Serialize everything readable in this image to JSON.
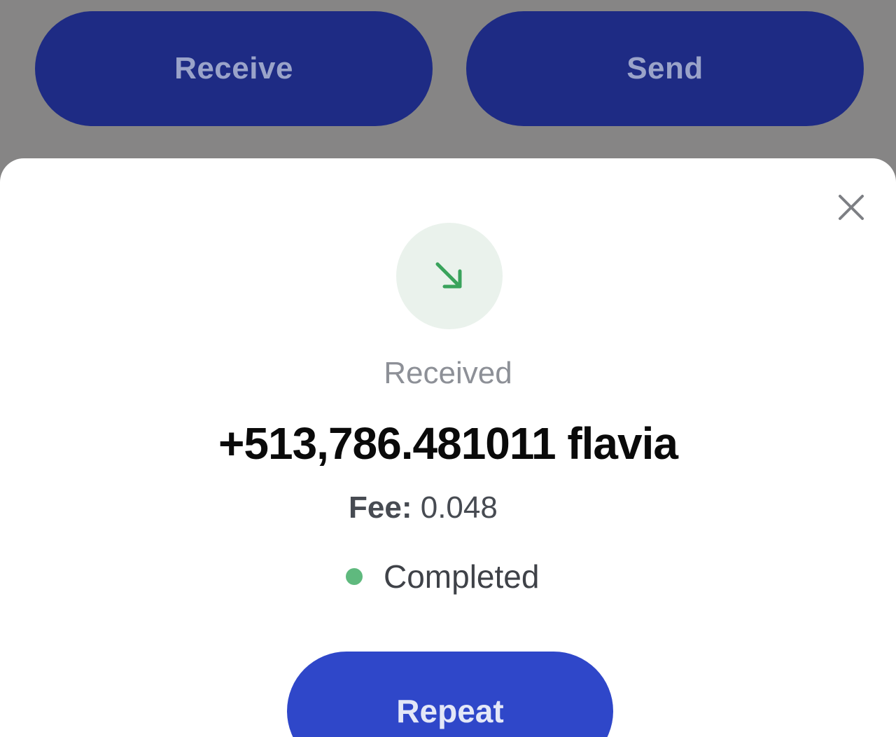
{
  "top_actions": {
    "receive_label": "Receive",
    "send_label": "Send"
  },
  "transaction": {
    "status_icon": "arrow-down-right-icon",
    "type_label": "Received",
    "amount": "+513,786.481011 flavia",
    "fee_label": "Fee:",
    "fee_value": "0.048",
    "status_text": "Completed",
    "status_color": "#5fb97e"
  },
  "sheet": {
    "close_icon": "close-icon",
    "repeat_label": "Repeat"
  },
  "colors": {
    "primary_dark": "#1e2b84",
    "primary": "#2f47c9",
    "success": "#5fb97e",
    "overlay": "#868585"
  }
}
